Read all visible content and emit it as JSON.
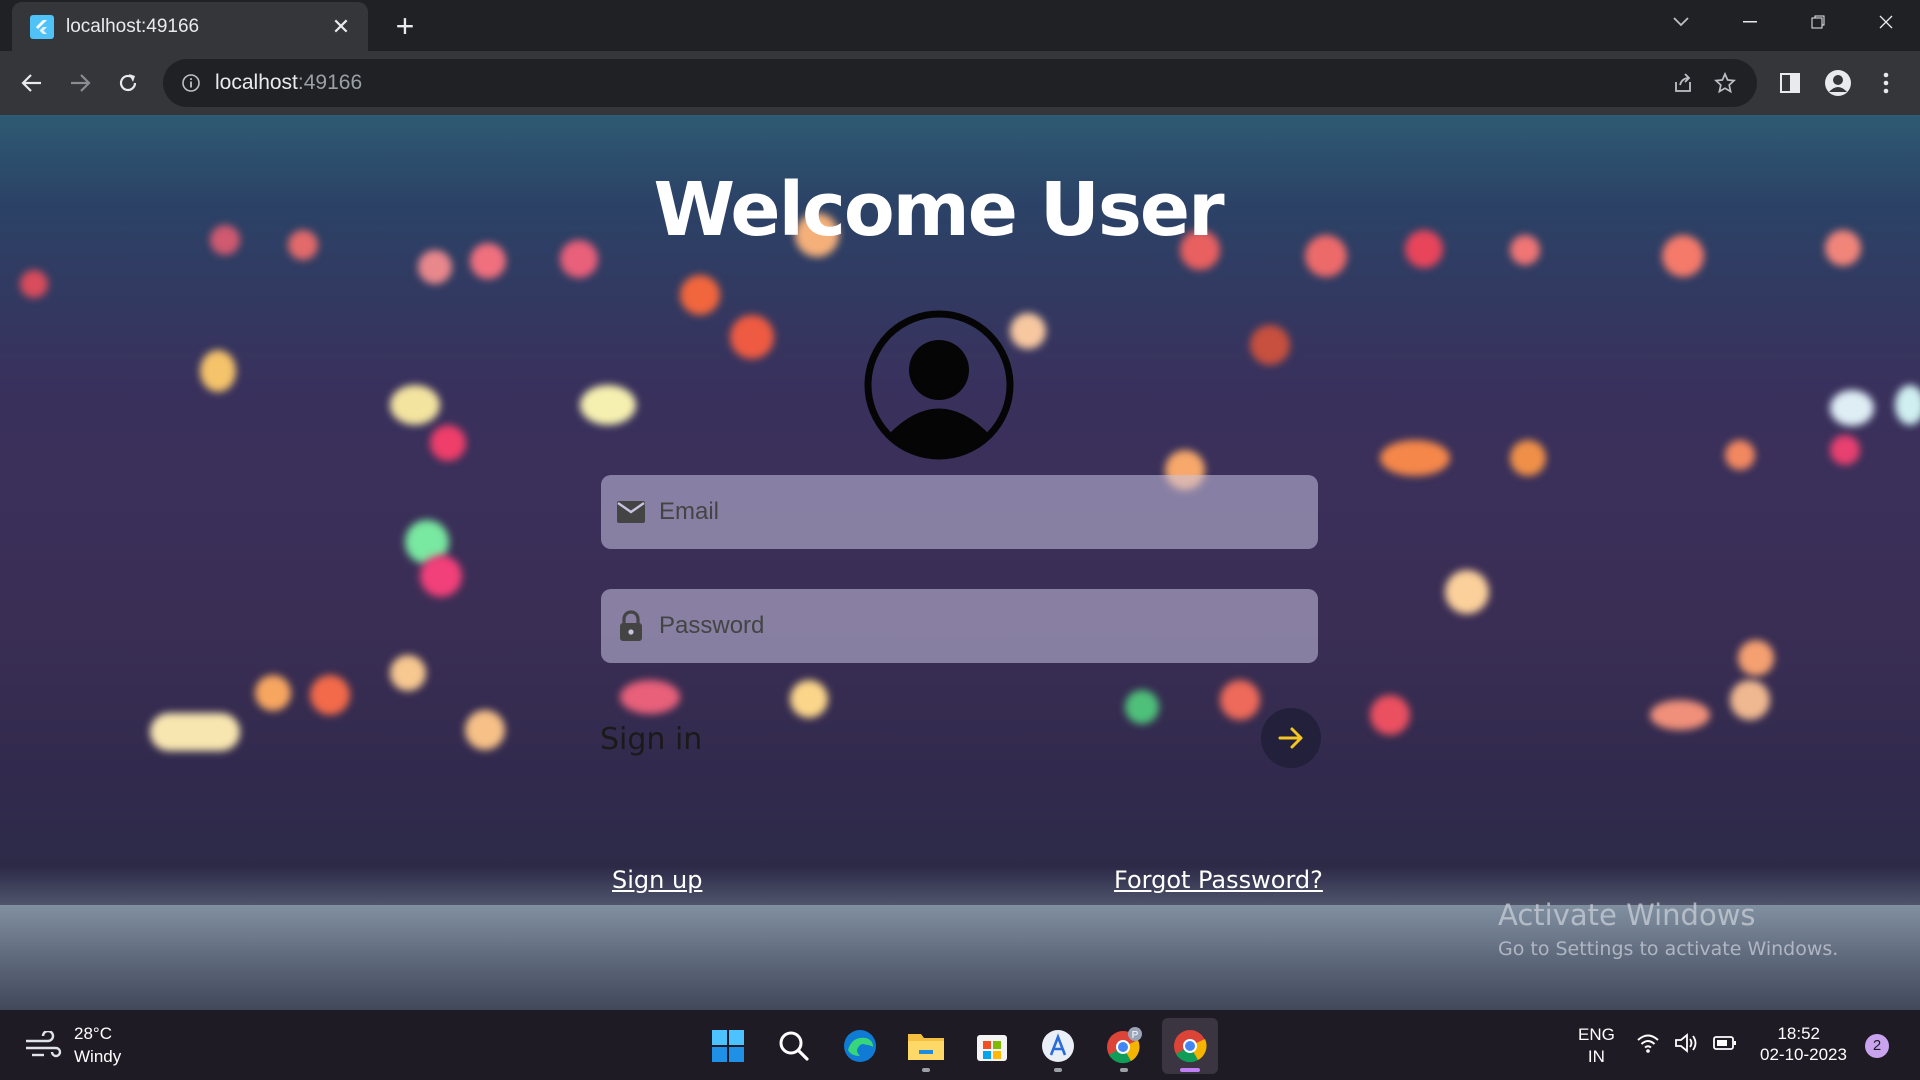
{
  "browser": {
    "tab_title": "localhost:49166",
    "url_host": "localhost",
    "url_port": ":49166"
  },
  "page": {
    "heading": "Welcome User",
    "email_placeholder": "Email",
    "password_placeholder": "Password",
    "signin_label": "Sign in",
    "signup_link": "Sign up",
    "forgot_link": "Forgot Password?"
  },
  "watermark": {
    "title": "Activate Windows",
    "subtitle": "Go to Settings to activate Windows."
  },
  "taskbar": {
    "weather_temp": "28°C",
    "weather_desc": "Windy",
    "lang_line1": "ENG",
    "lang_line2": "IN",
    "time": "18:52",
    "date": "02-10-2023",
    "notifications": "2",
    "apps": [
      "start",
      "search",
      "edge",
      "file-explorer",
      "microsoft-store",
      "app-store",
      "chrome-profile",
      "chrome"
    ]
  },
  "colors": {
    "accent_arrow": "#f3c623",
    "chrome_bg": "#202124",
    "toolbar_bg": "#35363a"
  }
}
